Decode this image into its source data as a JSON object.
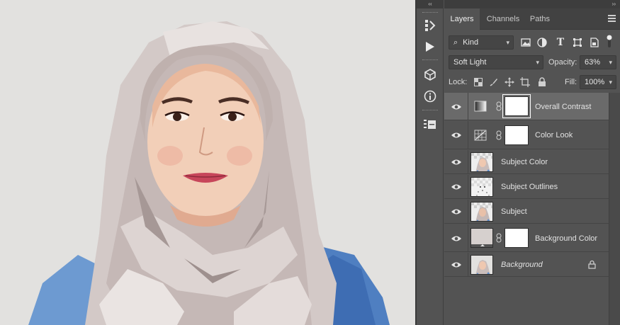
{
  "canvas": {
    "background": "#e2e1df",
    "subject": "cartoon portrait"
  },
  "toolstrip": {
    "collapse_glyph": "‹‹",
    "tools": [
      {
        "name": "history-brush-icon"
      },
      {
        "name": "play-action-icon"
      },
      {
        "name": "3d-cube-icon"
      },
      {
        "name": "info-icon"
      },
      {
        "name": "properties-icon"
      }
    ]
  },
  "panel": {
    "collapse_glyph": "››",
    "tabs": [
      {
        "label": "Layers",
        "active": true
      },
      {
        "label": "Channels",
        "active": false
      },
      {
        "label": "Paths",
        "active": false
      }
    ],
    "filter": {
      "kind_label": "Kind",
      "icons": [
        "image-filter-icon",
        "adjustment-filter-icon",
        "type-filter-icon",
        "shape-filter-icon",
        "smart-object-filter-icon",
        "filter-toggle-icon"
      ]
    },
    "blend_mode": "Soft Light",
    "opacity_label": "Opacity:",
    "opacity_value": "63%",
    "lock_label": "Lock:",
    "fill_label": "Fill:",
    "fill_value": "100%",
    "layers": [
      {
        "name": "Overall Contrast",
        "type": "adjustment",
        "selected": true
      },
      {
        "name": "Color Look",
        "type": "adjustment",
        "selected": false
      },
      {
        "name": "Subject Color",
        "type": "pixel",
        "selected": false
      },
      {
        "name": "Subject Outlines",
        "type": "pixel",
        "selected": false
      },
      {
        "name": "Subject",
        "type": "pixel",
        "selected": false
      },
      {
        "name": "Background Color",
        "type": "fill",
        "selected": false
      },
      {
        "name": "Background",
        "type": "background",
        "selected": false,
        "locked": true
      }
    ]
  },
  "colors": {
    "panel_bg": "#535353",
    "tab_bar": "#424242",
    "selected_row": "#6a6a6a",
    "field_bg": "#454545"
  }
}
